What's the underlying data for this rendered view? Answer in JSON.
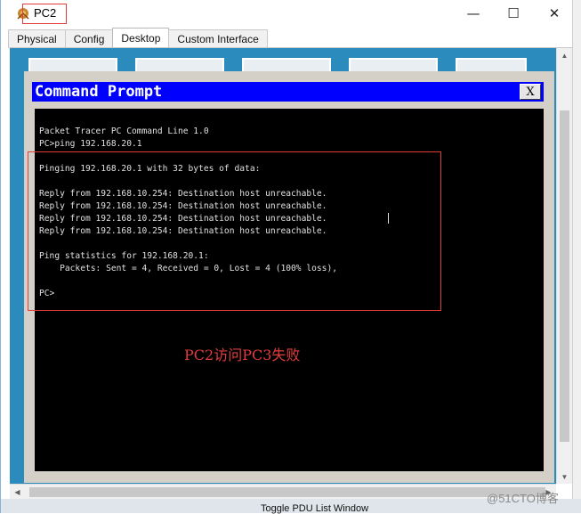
{
  "window": {
    "title": "PC2",
    "minimize_glyph": "—",
    "maximize_glyph": "☐",
    "close_glyph": "✕"
  },
  "tabs": [
    {
      "label": "Physical",
      "active": false
    },
    {
      "label": "Config",
      "active": false
    },
    {
      "label": "Desktop",
      "active": true
    },
    {
      "label": "Custom Interface",
      "active": false
    }
  ],
  "command_prompt": {
    "title": "Command Prompt",
    "close_label": "X",
    "lines": [
      "Packet Tracer PC Command Line 1.0",
      "PC>ping 192.168.20.1",
      "",
      "Pinging 192.168.20.1 with 32 bytes of data:",
      "",
      "Reply from 192.168.10.254: Destination host unreachable.",
      "Reply from 192.168.10.254: Destination host unreachable.",
      "Reply from 192.168.10.254: Destination host unreachable.",
      "Reply from 192.168.10.254: Destination host unreachable.",
      "",
      "Ping statistics for 192.168.20.1:",
      "    Packets: Sent = 4, Received = 0, Lost = 4 (100% loss),",
      "",
      "PC>"
    ]
  },
  "annotation": "PC2访问PC3失败",
  "bottom": {
    "toggle_pdu": "Toggle PDU List Window",
    "watermark": "@51CTO博客"
  },
  "colors": {
    "desktop_bg": "#2c8bbd",
    "prompt_title_bg": "#0000ff",
    "annotation": "#e23d3d"
  }
}
